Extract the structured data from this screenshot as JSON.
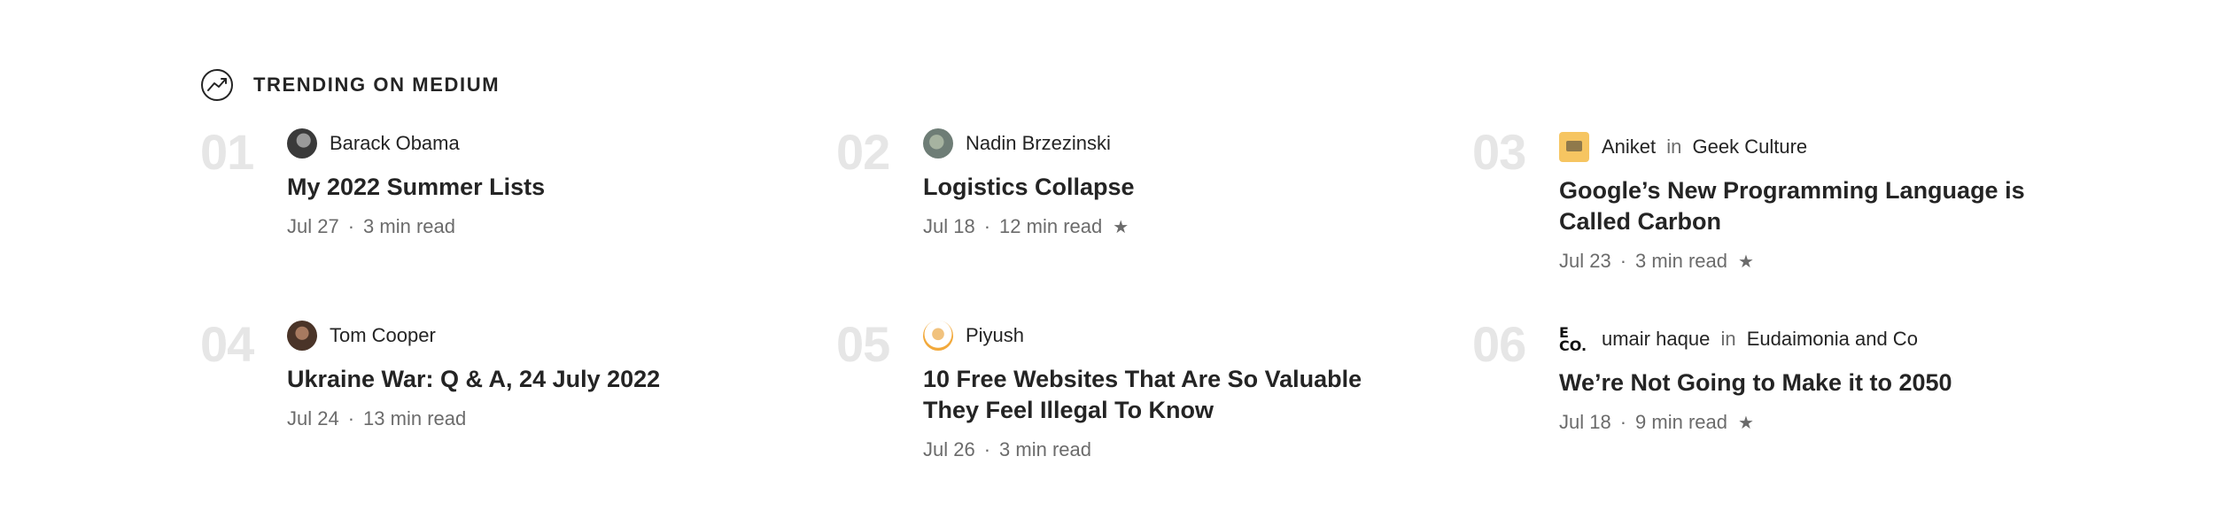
{
  "section": {
    "title": "TRENDING ON MEDIUM",
    "icon": "trending-up-icon"
  },
  "articles": [
    {
      "rank": "01",
      "author": "Barack Obama",
      "avatar": "avatar-obama",
      "in_text": "",
      "publication": "",
      "title": "My 2022 Summer Lists",
      "date": "Jul 27",
      "separator": "·",
      "read_time": "3 min read",
      "member_only": false
    },
    {
      "rank": "02",
      "author": "Nadin Brzezinski",
      "avatar": "avatar-nadin",
      "in_text": "",
      "publication": "",
      "title": "Logistics Collapse",
      "date": "Jul 18",
      "separator": "·",
      "read_time": "12 min read",
      "member_only": true,
      "star": "★"
    },
    {
      "rank": "03",
      "author": "Aniket",
      "avatar": "geek-culture-logo",
      "in_text": "in",
      "publication": "Geek Culture",
      "title": "Google’s New Programming Language is Called Carbon",
      "date": "Jul 23",
      "separator": "·",
      "read_time": "3 min read",
      "member_only": true,
      "star": "★"
    },
    {
      "rank": "04",
      "author": "Tom Cooper",
      "avatar": "avatar-cooper",
      "in_text": "",
      "publication": "",
      "title": "Ukraine War: Q & A, 24 July 2022",
      "date": "Jul 24",
      "separator": "·",
      "read_time": "13 min read",
      "member_only": false
    },
    {
      "rank": "05",
      "author": "Piyush",
      "avatar": "avatar-piyush",
      "in_text": "",
      "publication": "",
      "title": "10 Free Websites That Are So Valuable They Feel Illegal To Know",
      "date": "Jul 26",
      "separator": "·",
      "read_time": "3 min read",
      "member_only": false
    },
    {
      "rank": "06",
      "author": "umair haque",
      "avatar": "eudaimonia-logo",
      "logo_line1": "E",
      "logo_line2": "CO.",
      "in_text": "in",
      "publication": "Eudaimonia and Co",
      "title": "We’re Not Going to Make it to 2050",
      "date": "Jul 18",
      "separator": "·",
      "read_time": "9 min read",
      "member_only": true,
      "star": "★"
    }
  ]
}
